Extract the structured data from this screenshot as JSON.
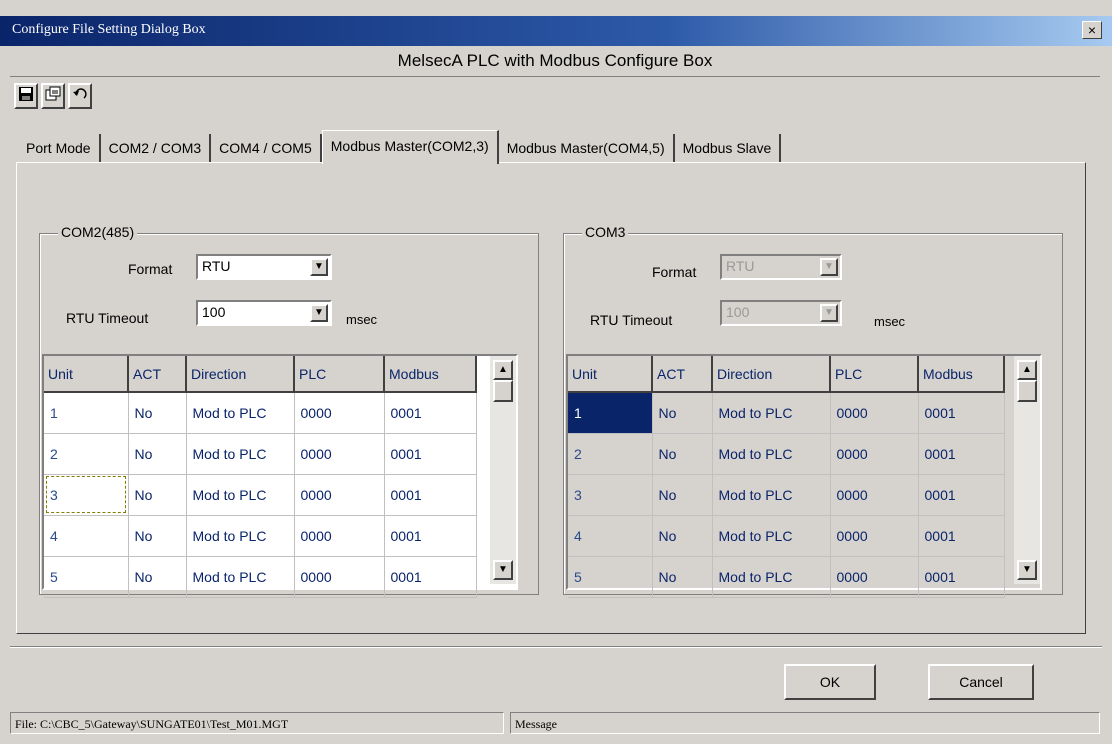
{
  "window": {
    "title": "Configure File Setting Dialog Box",
    "close_label": "×",
    "header": "MelsecA PLC with Modbus Configure Box"
  },
  "toolbar": {
    "buttons": [
      "save-icon",
      "export-icon",
      "undo-icon"
    ]
  },
  "tabs": [
    {
      "label": "Port Mode",
      "active": false
    },
    {
      "label": "COM2 / COM3",
      "active": false
    },
    {
      "label": "COM4 / COM5",
      "active": false
    },
    {
      "label": "Modbus Master(COM2,3)",
      "active": true
    },
    {
      "label": "Modbus Master(COM4,5)",
      "active": false
    },
    {
      "label": "Modbus Slave",
      "active": false
    }
  ],
  "left_group": {
    "title": "COM2(485)",
    "format_label": "Format",
    "format_value": "RTU",
    "timeout_label": "RTU Timeout",
    "timeout_value": "100",
    "unit": "msec",
    "columns": [
      "Unit",
      "ACT",
      "Direction",
      "PLC",
      "Modbus"
    ],
    "rows": [
      [
        "1",
        "No",
        "Mod to PLC",
        "0000",
        "0001"
      ],
      [
        "2",
        "No",
        "Mod to PLC",
        "0000",
        "0001"
      ],
      [
        "3",
        "No",
        "Mod to PLC",
        "0000",
        "0001"
      ],
      [
        "4",
        "No",
        "Mod to PLC",
        "0000",
        "0001"
      ],
      [
        "5",
        "No",
        "Mod to PLC",
        "0000",
        "0001"
      ]
    ]
  },
  "right_group": {
    "title": "COM3",
    "format_label": "Format",
    "format_value": "RTU",
    "timeout_label": "RTU Timeout",
    "timeout_value": "100",
    "unit": "msec",
    "columns": [
      "Unit",
      "ACT",
      "Direction",
      "PLC",
      "Modbus"
    ],
    "rows": [
      [
        "1",
        "No",
        "Mod to PLC",
        "0000",
        "0001"
      ],
      [
        "2",
        "No",
        "Mod to PLC",
        "0000",
        "0001"
      ],
      [
        "3",
        "No",
        "Mod to PLC",
        "0000",
        "0001"
      ],
      [
        "4",
        "No",
        "Mod to PLC",
        "0000",
        "0001"
      ],
      [
        "5",
        "No",
        "Mod to PLC",
        "0000",
        "0001"
      ]
    ]
  },
  "buttons": {
    "ok": "OK",
    "cancel": "Cancel"
  },
  "status": {
    "file": "File: C:\\CBC_5\\Gateway\\SUNGATE01\\Test_M01.MGT",
    "message": "Message"
  },
  "colors": {
    "title_gradient_start": "#0a246a",
    "title_gradient_end": "#a6caf0",
    "face": "#d6d3ce",
    "grid_text": "#0a246a",
    "selection": "#0a246a"
  }
}
